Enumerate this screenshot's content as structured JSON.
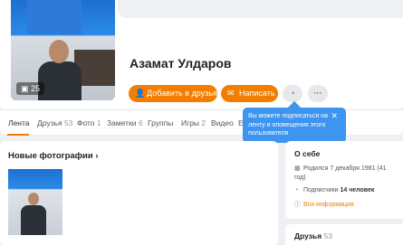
{
  "profile": {
    "name": "Азамат Улдаров",
    "photo_count": "25"
  },
  "actions": {
    "add_friend": "Добавить в друзья",
    "write": "Написать",
    "more": "···"
  },
  "tabs": [
    {
      "label": "Лента",
      "count": ""
    },
    {
      "label": "Друзья",
      "count": "53"
    },
    {
      "label": "Фото",
      "count": "1"
    },
    {
      "label": "Заметки",
      "count": "6"
    },
    {
      "label": "Группы",
      "count": ""
    },
    {
      "label": "Игры",
      "count": "2"
    },
    {
      "label": "Видео",
      "count": ""
    },
    {
      "label": "Е",
      "count": ""
    }
  ],
  "tooltip": {
    "text": "Вы можете подписаться на ленту и оповещения этого пользователя",
    "close": "✕"
  },
  "photos": {
    "title": "Новые фотографии",
    "chevron": "›"
  },
  "about": {
    "title": "О себе",
    "birth": "Родился 7 декабря 1981 (41 год)",
    "followers_label": "Подписчики",
    "followers_value": "14 человек",
    "all_info": "Вся информация"
  },
  "friends": {
    "title": "Друзья",
    "count": "53"
  },
  "colors": {
    "accent": "#f27d00",
    "tooltip": "#3d95f0",
    "background": "#eef0f3"
  }
}
